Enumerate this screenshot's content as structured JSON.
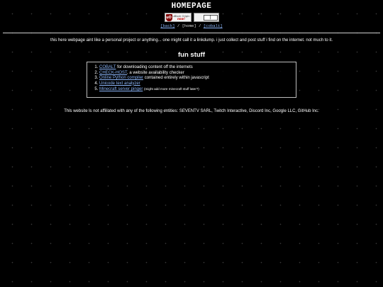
{
  "header": {
    "title": "HOMEPAGE",
    "ublock_badge": {
      "line1": "uBlock Origin",
      "line2": "now!",
      "shield": "uO"
    },
    "select_value": "|",
    "nav": {
      "back": "[back]",
      "separator": "/",
      "home": "[home]",
      "cobalt": "[cobalt]"
    }
  },
  "intro": "this here webpage aint like a personal project or anything... one might call it a linkdump. i just collect and post stuff i find on the internet. not much to it.",
  "section_title": "fun stuff",
  "links": [
    {
      "link": "COBALT",
      "rest": " for downloading content off the internets",
      "note": ""
    },
    {
      "link": "CHECK-HOST",
      "rest": ", a website availability checker",
      "note": ""
    },
    {
      "link": "Online Python compiler",
      "rest": " contained entirely within javascript",
      "note": ""
    },
    {
      "link": "Unicode text analyzer",
      "rest": "",
      "note": ""
    },
    {
      "link": "Minecraft server pinger",
      "rest": " ",
      "note": "(might add more minecraft stuff later?)"
    }
  ],
  "disclaimer": "This website is not affiliated with any of the following entities: SEVENTV SARL, Twitch Interactive, Discord Inc, Google LLC, GitHub Inc."
}
